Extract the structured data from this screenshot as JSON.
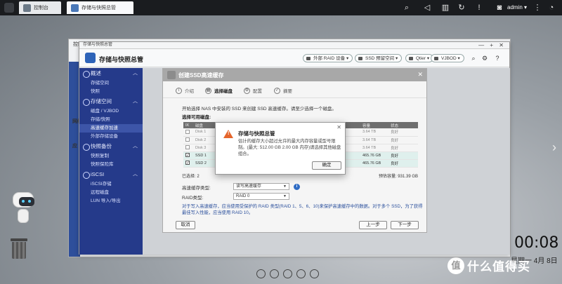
{
  "topbar": {
    "tabs": [
      {
        "label": "控制台"
      },
      {
        "label": "存储与快照总管"
      }
    ],
    "user": "admin ▾"
  },
  "window": {
    "bar_title": "存储与快照总管",
    "app_title": "存储与快照总管",
    "header_buttons": [
      "外部 RAID 设备 ▾",
      "SSD 预留空间 ▾",
      "Qtier ▾",
      "VJBOD ▾"
    ]
  },
  "control_panel": {
    "title": "控制台",
    "ghost_labels": [
      "网络",
      "应"
    ]
  },
  "sidebar": {
    "groups": [
      {
        "label": "概述",
        "items": [
          "存储空间",
          "快照"
        ]
      },
      {
        "label": "存储空间",
        "items": [
          "磁盘 / VJBOD",
          "存储/快照",
          "高速缓存加速",
          "外部存储设备"
        ]
      },
      {
        "label": "快照备份",
        "items": [
          "快照复制",
          "快照保险库"
        ]
      },
      {
        "label": "iSCSI",
        "items": [
          "iSCSI存储",
          "远程磁盘",
          "LUN 导入/导出"
        ]
      }
    ]
  },
  "wizard": {
    "title": "创建SSD高速缓存",
    "steps": [
      {
        "num": "i",
        "label": "介绍"
      },
      {
        "num": "▤",
        "label": "选择磁盘"
      },
      {
        "num": "⚙",
        "label": "配置"
      },
      {
        "num": "✓",
        "label": "摘要"
      }
    ],
    "intro_text": "开始选择 NAS 中安装的 SSD 来创建 SSD 高速缓存。请至少选择一个磁盘。",
    "table_title": "选择可用磁盘:",
    "table_headers": [
      "Ⅸ",
      "磁盘",
      "",
      "",
      "",
      "",
      "容量",
      "状态"
    ],
    "rows": [
      {
        "disk": "Disk 1",
        "capacity": "3.64 TB",
        "status": "良好",
        "selected": false
      },
      {
        "disk": "Disk 2",
        "capacity": "3.64 TB",
        "status": "良好",
        "selected": false
      },
      {
        "disk": "Disk 3",
        "capacity": "3.64 TB",
        "status": "良好",
        "selected": false
      },
      {
        "disk": "SSD 1",
        "capacity": "465.76 GB",
        "status": "良好",
        "selected": true
      },
      {
        "disk": "SSD 2",
        "capacity": "465.76 GB",
        "status": "良好",
        "selected": true
      }
    ],
    "selected_count": "已选择: 2",
    "estimated": "预估容量: 931.39 GB",
    "cache_type_label": "高速缓存类型:",
    "cache_type_value": "读写高速缓存",
    "raid_label": "RAID类型:",
    "raid_value": "RAID 0",
    "note": "对于写入高速缓存，应当使用受保护的 RAID 类型(RAID 1、5、6、10)来保护高速缓存中的数据。对于多个 SSD，为了获得最佳写入性能，应当使用 RAID 10。",
    "cancel": "取消",
    "prev": "上一步",
    "next": "下一步"
  },
  "modal": {
    "title": "存储与快照总管",
    "body": "估计的缓存大小超过允许的最大内存容量或型号限制。(最大: 512.00 GB 2.00 GB 内存)请选择其他磁盘组合。",
    "ok": "确定"
  },
  "desktop": {
    "clock": "00:08",
    "date": "星期一  4月 8日",
    "watermark": "什么值得买",
    "watermark_badge": "值"
  },
  "colors": {
    "sidebar": "#253a8a",
    "topbar": "#1a1c1f",
    "warning": "#e5652b"
  }
}
